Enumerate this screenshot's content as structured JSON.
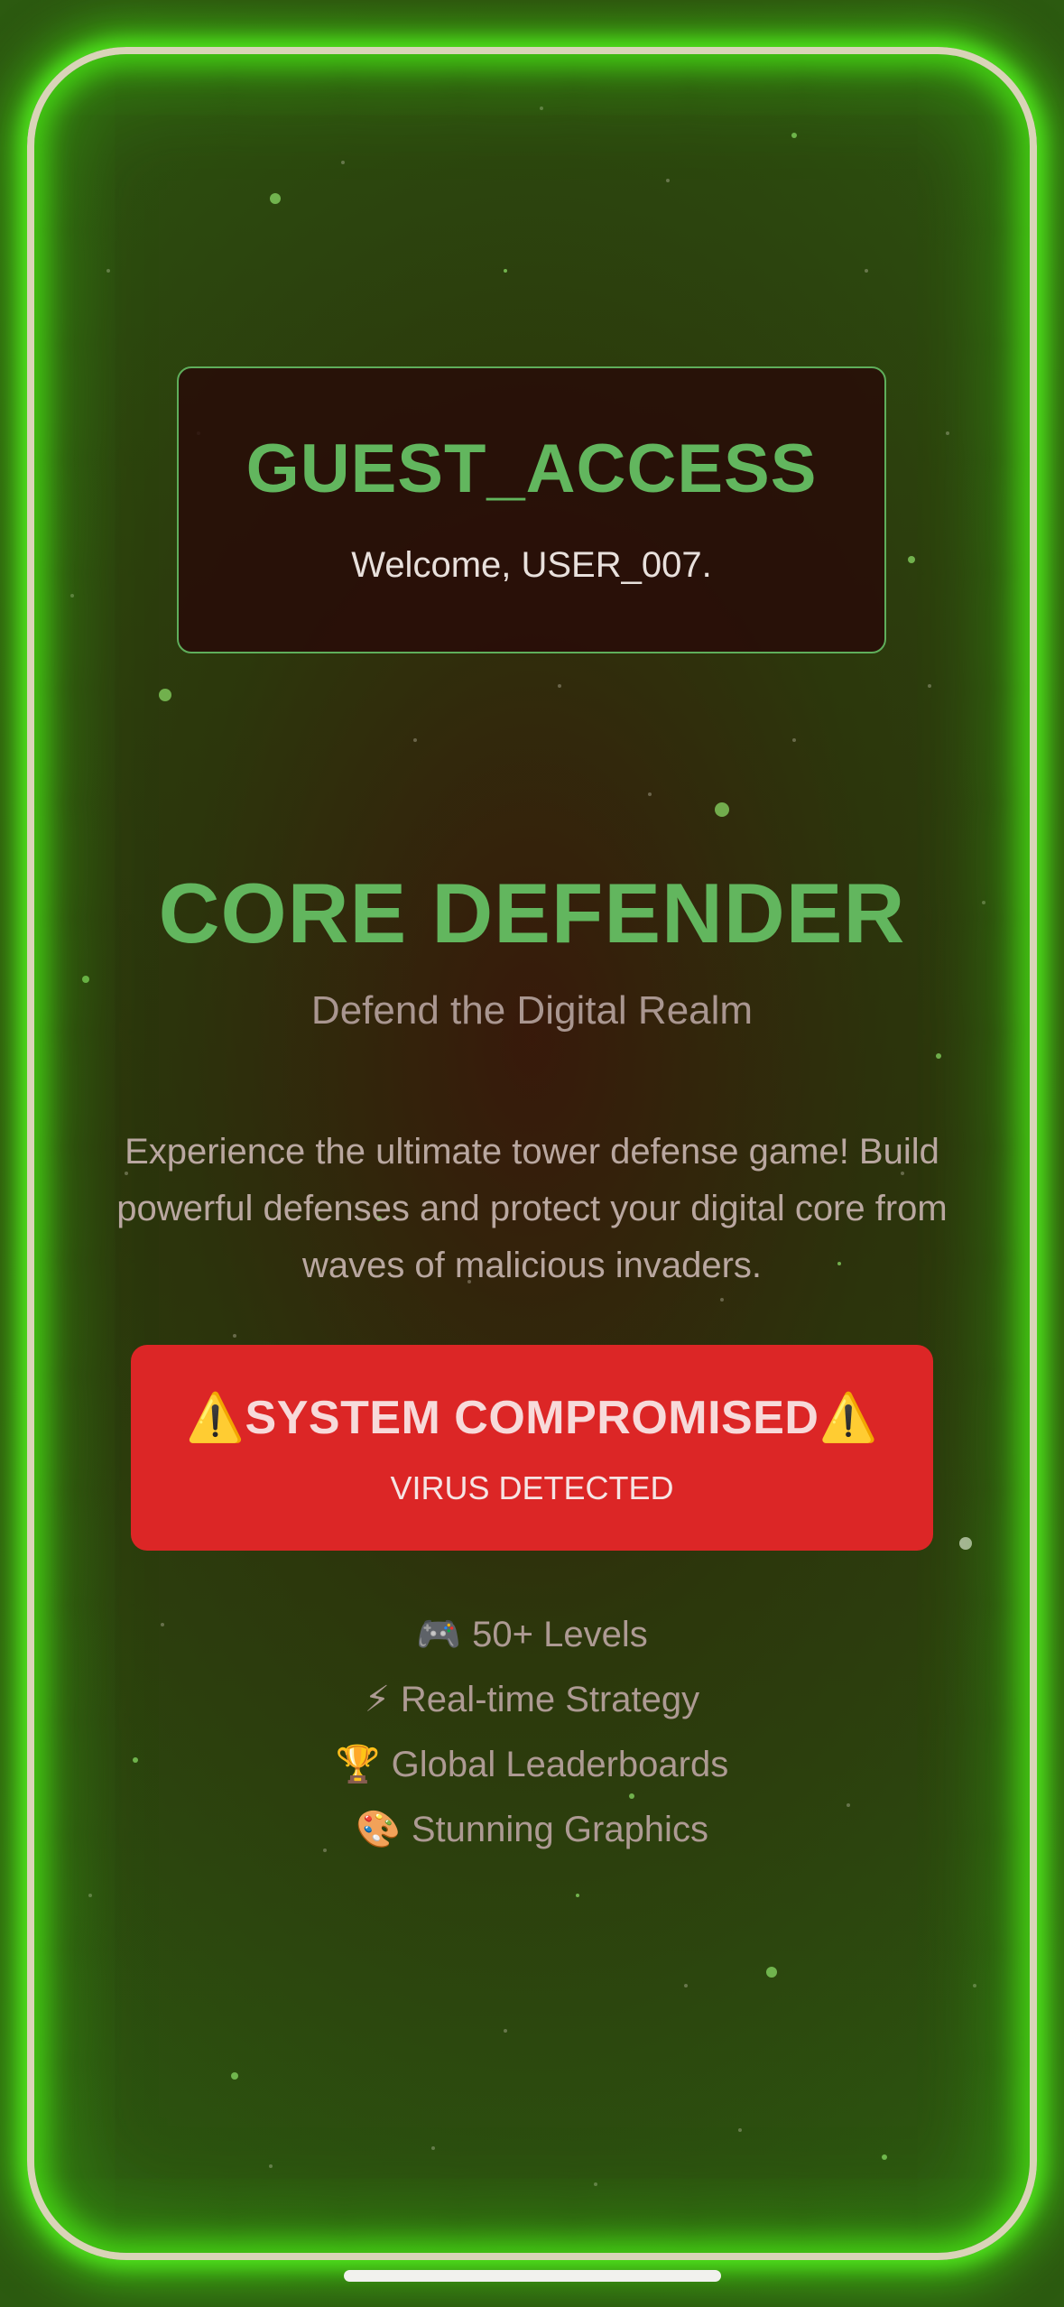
{
  "access_card": {
    "title": "GUEST_ACCESS",
    "welcome": "Welcome, USER_007."
  },
  "game": {
    "title": "CORE DEFENDER",
    "subtitle": "Defend the Digital Realm",
    "description": "Experience the ultimate tower defense game! Build powerful defenses and protect your digital core from waves of malicious invaders."
  },
  "alert": {
    "title": "⚠️SYSTEM COMPROMISED⚠️",
    "subtitle": "VIRUS DETECTED",
    "color": "#dc2626"
  },
  "features": [
    {
      "icon": "gamepad-icon",
      "glyph": "🎮",
      "label": "50+ Levels"
    },
    {
      "icon": "lightning-icon",
      "glyph": "⚡",
      "label": "Real-time Strategy"
    },
    {
      "icon": "trophy-icon",
      "glyph": "🏆",
      "label": "Global Leaderboards"
    },
    {
      "icon": "palette-icon",
      "glyph": "🎨",
      "label": "Stunning Graphics"
    }
  ],
  "colors": {
    "accent_green": "#62b65e",
    "glow_green": "#50e61e",
    "frame": "#d9d4b8"
  }
}
